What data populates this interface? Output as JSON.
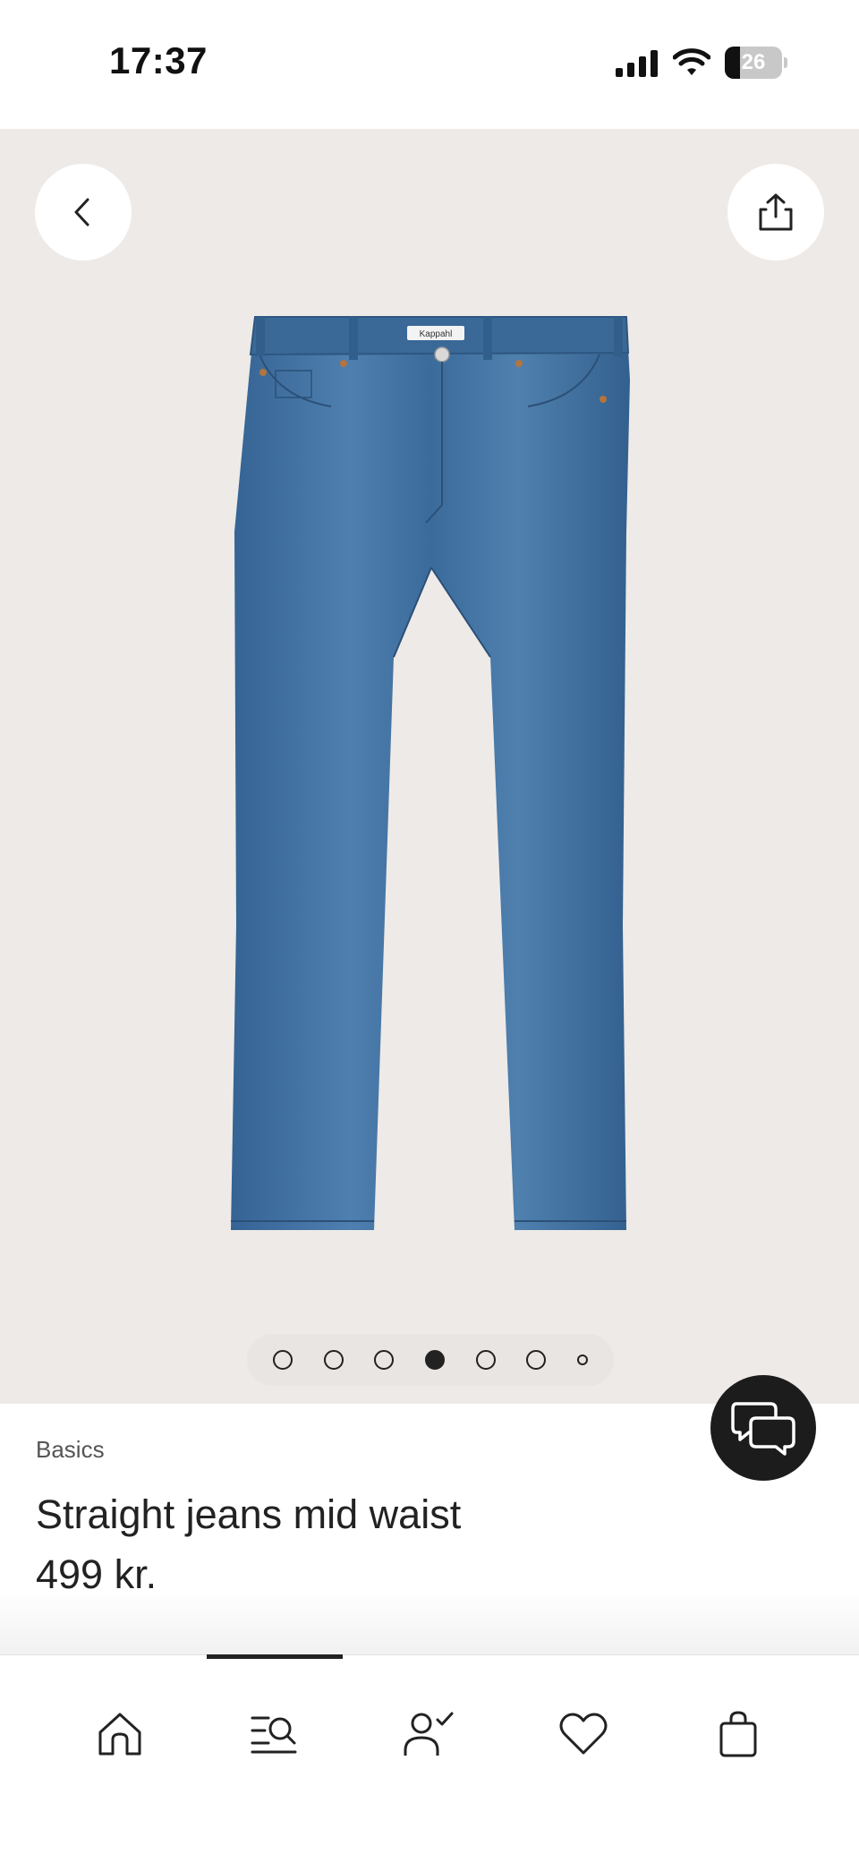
{
  "status_bar": {
    "time": "17:37",
    "battery_level": "26",
    "icons": [
      "signal-icon",
      "wifi-icon",
      "battery-icon"
    ]
  },
  "gallery": {
    "image_count": 7,
    "active_index": 3,
    "buttons": [
      "back-icon",
      "share-icon"
    ],
    "waistband_label": "Kappahl"
  },
  "product": {
    "brand": "Basics",
    "name": "Straight jeans mid waist",
    "price": "499 kr."
  },
  "chat": {
    "icon": "chat-bubbles-icon"
  },
  "bottom_nav": {
    "active": "search",
    "items": [
      "home-icon",
      "search-list-icon",
      "account-icon",
      "heart-icon",
      "shopping-bag-icon"
    ]
  },
  "colors": {
    "gallery_background": "#eeeae7",
    "denim": "#3f6f9e",
    "chat_button": "#1c1c1c"
  }
}
